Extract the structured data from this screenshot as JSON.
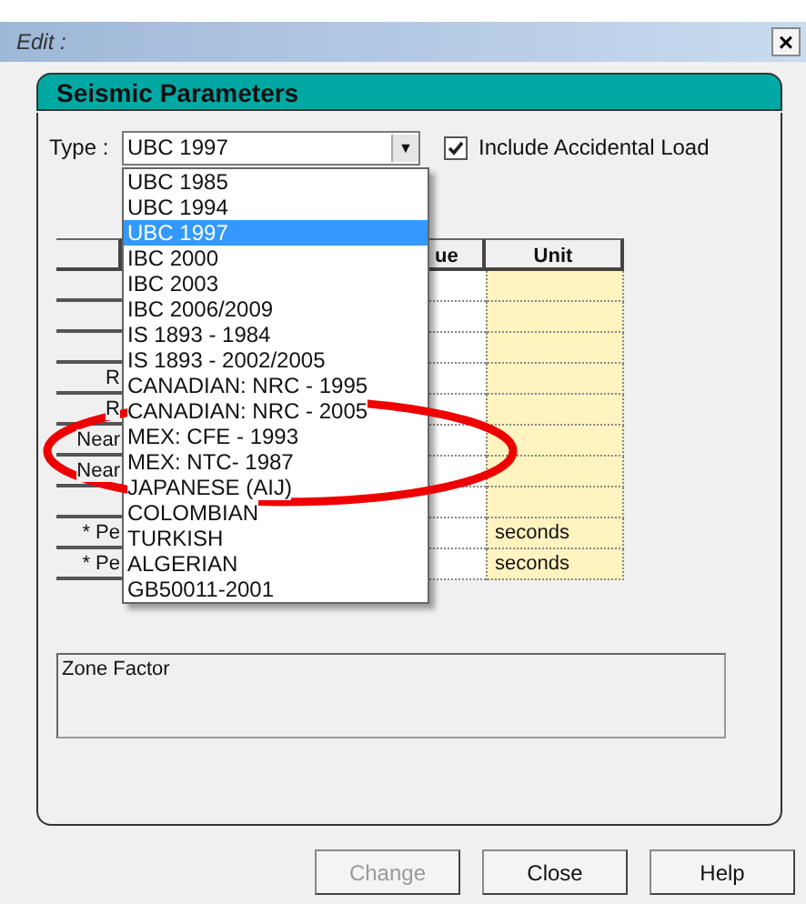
{
  "window": {
    "title": "Edit :",
    "close": "×"
  },
  "section_title": "Seismic Parameters",
  "type_field": {
    "label": "Type :",
    "value": "UBC 1997",
    "arrow": "▼"
  },
  "include_accidental_load": {
    "label": "Include Accidental Load",
    "checked": true
  },
  "table": {
    "columns": [
      "ue",
      "Unit"
    ],
    "rows": [
      {},
      {},
      {},
      {
        "parameter": "R"
      },
      {
        "parameter": "R"
      },
      {
        "parameter": "Near"
      },
      {
        "parameter": "Near"
      },
      {},
      {
        "parameter": "* Pe",
        "unit": "seconds"
      },
      {
        "parameter": "* Pe",
        "unit": "seconds"
      }
    ]
  },
  "type_dropdown": [
    {
      "label": "UBC 1985",
      "selected": false
    },
    {
      "label": "UBC 1994",
      "selected": false
    },
    {
      "label": "UBC 1997",
      "selected": true
    },
    {
      "label": "IBC 2000",
      "selected": false
    },
    {
      "label": "IBC 2003",
      "selected": false
    },
    {
      "label": "IBC 2006/2009",
      "selected": false
    },
    {
      "label": "IS 1893 - 1984",
      "selected": false
    },
    {
      "label": "IS 1893 - 2002/2005",
      "selected": false
    },
    {
      "label": "CANADIAN: NRC - 1995",
      "selected": false
    },
    {
      "label": "CANADIAN: NRC - 2005",
      "selected": false
    },
    {
      "label": "MEX: CFE - 1993",
      "selected": false
    },
    {
      "label": "MEX: NTC- 1987",
      "selected": false
    },
    {
      "label": "JAPANESE (AIJ)",
      "selected": false
    },
    {
      "label": "COLOMBIAN",
      "selected": false
    },
    {
      "label": "TURKISH",
      "selected": false
    },
    {
      "label": "ALGERIAN",
      "selected": false
    },
    {
      "label": "GB50011-2001",
      "selected": false
    }
  ],
  "annotation": {
    "kind": "ellipse",
    "color": "#ee0000"
  },
  "description": "Zone Factor",
  "buttons": [
    {
      "label": "Change",
      "disabled": true
    },
    {
      "label": "Close",
      "disabled": false
    },
    {
      "label": "Help",
      "disabled": false
    }
  ]
}
